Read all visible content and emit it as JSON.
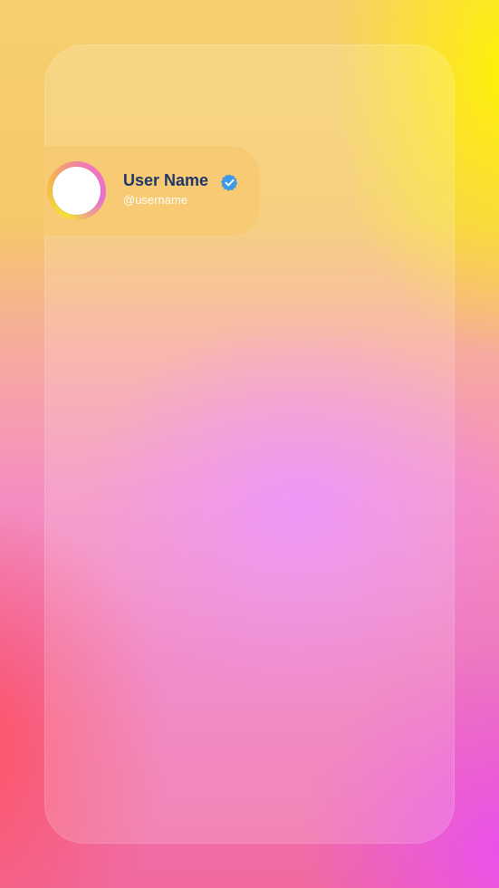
{
  "profile": {
    "display_name": "User Name",
    "handle": "@username",
    "verified": true,
    "verified_icon": "verified-badge-icon",
    "avatar_icon": "avatar"
  },
  "colors": {
    "name_text": "#1d3769",
    "handle_text": "#ffffff",
    "badge": "#3d98e6",
    "avatar_ring_start": "#f3e23a",
    "avatar_ring_end": "#e86fd0"
  }
}
